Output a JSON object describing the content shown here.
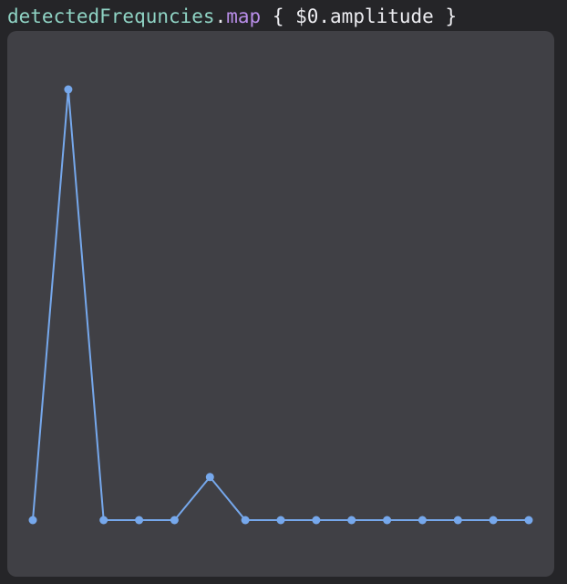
{
  "code": {
    "receiver": "detectedFrequncies",
    "dot": ".",
    "method": "map",
    "closure": " { $0.amplitude }"
  },
  "colors": {
    "background": "#252528",
    "panel": "#404045",
    "identifier": "#8fd3c4",
    "method": "#b88de8",
    "plain_text": "#ececf0",
    "series": "#76a8ec"
  },
  "chart_data": {
    "type": "line",
    "title": "",
    "xlabel": "",
    "ylabel": "",
    "grid": false,
    "x": [
      0,
      1,
      2,
      3,
      4,
      5,
      6,
      7,
      8,
      9,
      10,
      11,
      12,
      13,
      14
    ],
    "ylim": [
      0,
      1
    ],
    "series": [
      {
        "values": [
          0,
          1,
          0,
          0,
          0,
          0.1,
          0,
          0,
          0,
          0,
          0,
          0,
          0,
          0,
          0
        ]
      }
    ]
  }
}
